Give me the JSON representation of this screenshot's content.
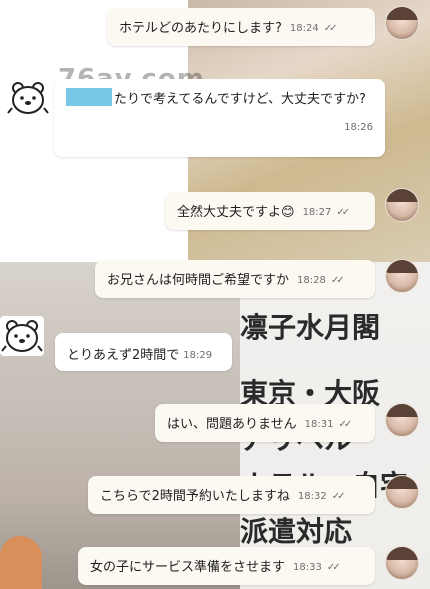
{
  "background": {
    "watermark": "76av.com",
    "overlay_lines": [
      "凛子水月閣",
      "東京・大阪",
      "アリベル",
      "ホテル・自宅",
      "派遣対応"
    ]
  },
  "messages": [
    {
      "side": "out",
      "text": "ホテルどのあたりにします?",
      "time": "18:24",
      "read": "✓✓"
    },
    {
      "side": "in",
      "text_after_redaction": "たりで考えてるんですけど、大丈夫ですか?",
      "time": "18:26"
    },
    {
      "side": "out",
      "text": "全然大丈夫ですよ😊",
      "time": "18:27",
      "read": "✓✓"
    },
    {
      "side": "out",
      "text": "お兄さんは何時間ご希望ですか",
      "time": "18:28",
      "read": "✓✓"
    },
    {
      "side": "in",
      "text": "とりあえず2時間で",
      "time": "18:29"
    },
    {
      "side": "out",
      "text": "はい、問題ありません",
      "time": "18:31",
      "read": "✓✓"
    },
    {
      "side": "out",
      "text": "こちらで2時間予約いたしますね",
      "time": "18:32",
      "read": "✓✓"
    },
    {
      "side": "out",
      "text": "女の子にサービス準備をさせます",
      "time": "18:33",
      "read": "✓✓"
    }
  ],
  "colors": {
    "redaction": "#76c7e6",
    "outgoing_bubble": "#fbf9f2",
    "incoming_bubble": "#ffffff"
  },
  "icons": {
    "bot_avatar": "polar-bear-icon",
    "user_avatar": "profile-photo"
  }
}
